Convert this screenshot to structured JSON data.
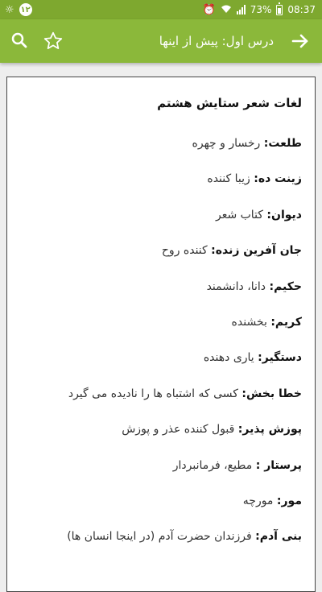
{
  "status_bar": {
    "time": "08:37",
    "battery": "73%",
    "notification_count": "۱۲"
  },
  "app_bar": {
    "title": "درس اول: پیش از اینها",
    "icons": [
      "search-icon",
      "star-outline-icon",
      "back-arrow-icon"
    ]
  },
  "content": {
    "heading": "لغات شعر ستایش هشتم",
    "entries": [
      {
        "term": "طلعت:",
        "definition": " رخسار و چهره"
      },
      {
        "term": "زینت ده:",
        "definition": " زیبا کننده"
      },
      {
        "term": "دیوان:",
        "definition": " کتاب شعر"
      },
      {
        "term": "جان آفرین زنده:",
        "definition": " کننده روح"
      },
      {
        "term": "حکیم:",
        "definition": " دانا، دانشمند"
      },
      {
        "term": "کریم:",
        "definition": " بخشنده"
      },
      {
        "term": "دستگیر:",
        "definition": " یاری دهنده"
      },
      {
        "term": "خطا بخش:",
        "definition": " کسی که اشتباه ها را نادیده می گیرد"
      },
      {
        "term": "پوزش پذیر:",
        "definition": " قبول کننده عذر و پوزش"
      },
      {
        "term": "پرستار :",
        "definition": " مطیع، فرمانبردار"
      },
      {
        "term": "مور:",
        "definition": " مورچه"
      },
      {
        "term": "بنی آدم:",
        "definition": " فرزندان حضرت آدم (در اینجا انسان ها)"
      },
      {
        "term": "",
        "definition": ""
      }
    ]
  },
  "colors": {
    "status_bar": "#7ea82f",
    "app_bar": "#8bb83a",
    "background": "#eeeeee",
    "card": "#ffffff"
  }
}
